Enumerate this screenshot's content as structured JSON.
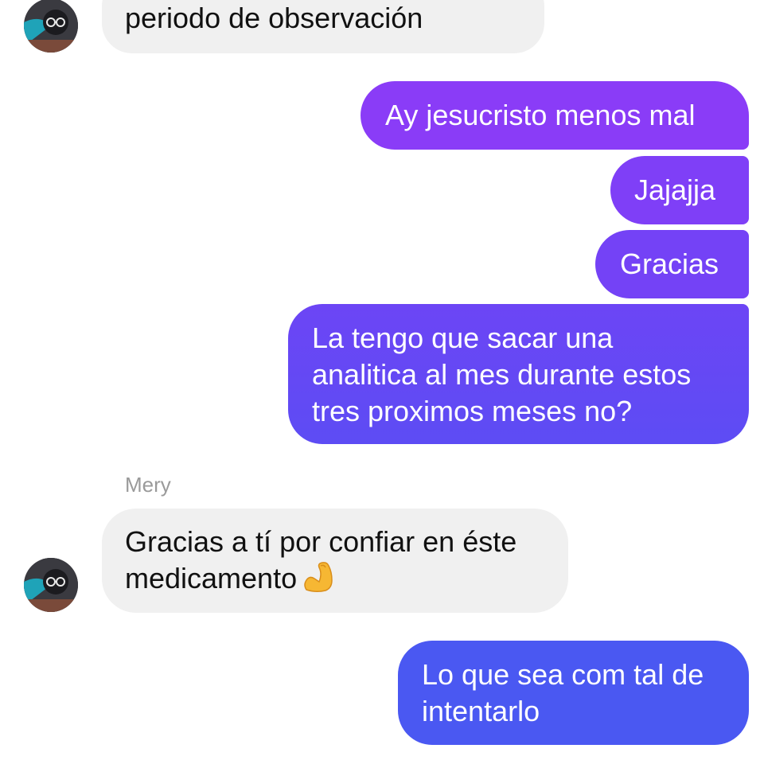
{
  "messages": [
    {
      "side": "in",
      "text": "periodo de observación"
    },
    {
      "side": "out",
      "text": "Ay jesucristo menos mal"
    },
    {
      "side": "out",
      "text": "Jajajja"
    },
    {
      "side": "out",
      "text": "Gracias"
    },
    {
      "side": "out",
      "lines": [
        "La tengo que sacar una",
        "analitica al mes durante estos",
        "tres proximos meses no?"
      ]
    },
    {
      "side": "in",
      "sender": "Mery",
      "lines": [
        "Gracias a tí por confiar en éste",
        "medicamento"
      ],
      "emoji": "flexed-biceps-icon"
    },
    {
      "side": "out",
      "lines": [
        "Lo que sea com tal de",
        "intentarlo"
      ]
    }
  ],
  "colors": {
    "incoming_bubble": "#f0f0f0",
    "outgoing_top": "#8a3cf7",
    "outgoing_mid": "#6a45f5",
    "outgoing_bottom": "#4a58f2",
    "sender_name": "#9a9a9a"
  }
}
